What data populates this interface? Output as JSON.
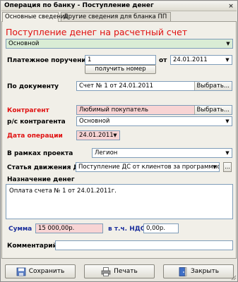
{
  "window": {
    "title": "Операция по банку - Поступление денег"
  },
  "tabs": [
    {
      "label": "Основные сведения",
      "active": true
    },
    {
      "label": "Другие сведения для бланка ПП",
      "active": false
    }
  ],
  "form": {
    "heading": "Поступление денег на расчетный счет",
    "type_select": "Основной",
    "payment_order": {
      "label": "Платежное поручение №",
      "number": "1",
      "from_label": "от",
      "date": "24.01.2011",
      "get_number_button": "получить номер"
    },
    "document": {
      "label": "По документу",
      "value": "Счет № 1 от 24.01.2011",
      "button": "Выбрать..."
    },
    "counterparty": {
      "label": "Контрагент",
      "value": "Любимый покупатель",
      "button": "Выбрать..."
    },
    "counterparty_account": {
      "label": "р/с контрагента",
      "value": "Основной"
    },
    "operation_date": {
      "label": "Дата операции",
      "value": "24.01.2011"
    },
    "project": {
      "label": "В рамках проекта",
      "value": "Легион"
    },
    "cash_flow_item": {
      "label": "Статья движения ДС",
      "value": "Поступление ДС от клиентов за программное обес",
      "ellipsis": "..."
    },
    "purpose": {
      "label": "Назначение денег",
      "value": "Оплата счета № 1 от 24.01.2011г."
    },
    "amount": {
      "label": "Сумма",
      "value": "15 000,00р."
    },
    "vat": {
      "label": "в т.ч. НДС",
      "value": "0,00р."
    },
    "comment": {
      "label": "Комментарий",
      "value": ""
    }
  },
  "buttons": {
    "save": "Сохранить",
    "print": "Печать",
    "close": "Закрыть"
  },
  "icons": {
    "close_x": "×",
    "combo_arrow": "▼"
  },
  "colors": {
    "required_label": "#e01010",
    "sum_label": "#1c2f9c",
    "pink_field": "#f8d4d4",
    "green_field": "#d9ecd5"
  }
}
